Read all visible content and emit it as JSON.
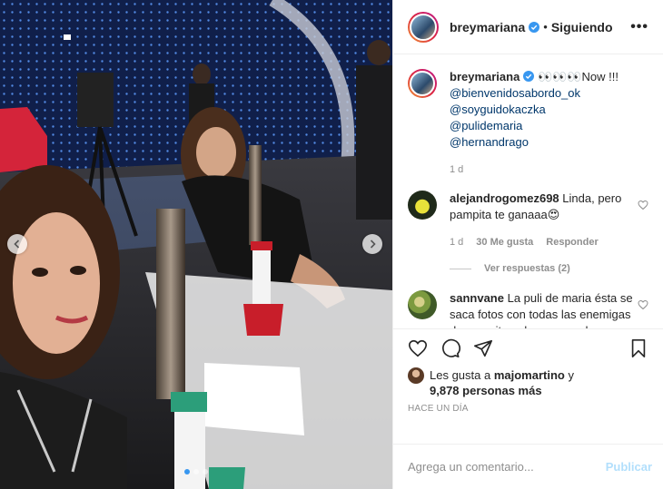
{
  "media": {
    "slides": 3,
    "active_slide": 0
  },
  "header": {
    "username": "breymariana",
    "bullet": "•",
    "follow_label": "Siguiendo",
    "more_icon": "more-horizontal-icon",
    "more_label": "•••"
  },
  "caption": {
    "username": "breymariana",
    "emojis": "👀👀👀",
    "text": "Now !!!",
    "mentions": [
      "@bienvenidosabordo_ok",
      "@soyguidokaczka",
      "@pulidemaria",
      "@hernandrago"
    ],
    "time": "1 d"
  },
  "comments": [
    {
      "username": "alejandrogomez698",
      "text": "Linda, pero pampita te ganaaa😍",
      "time": "1 d",
      "likes": "30 Me gusta",
      "reply_label": "Responder",
      "view_replies": "Ver respuestas (2)"
    },
    {
      "username": "sannvane",
      "text": "La puli de maria ésta se saca fotos con todas las enemigas de pampita y despues anda llorando por todos lados."
    }
  ],
  "actions": {
    "like_icon": "heart-icon",
    "comment_icon": "comment-icon",
    "share_icon": "share-icon",
    "save_icon": "bookmark-icon",
    "likes_prefix": "Les gusta a",
    "likes_user": "majomartino",
    "likes_join": "y",
    "likes_count": "9,878 personas más",
    "posted_ago": "HACE UN DÍA"
  },
  "add_comment": {
    "placeholder": "Agrega un comentario...",
    "publish_label": "Publicar"
  },
  "colors": {
    "accent": "#3897f0",
    "link": "#00376b",
    "publish_disabled": "#b2dffc",
    "verified": "#3897f0"
  }
}
